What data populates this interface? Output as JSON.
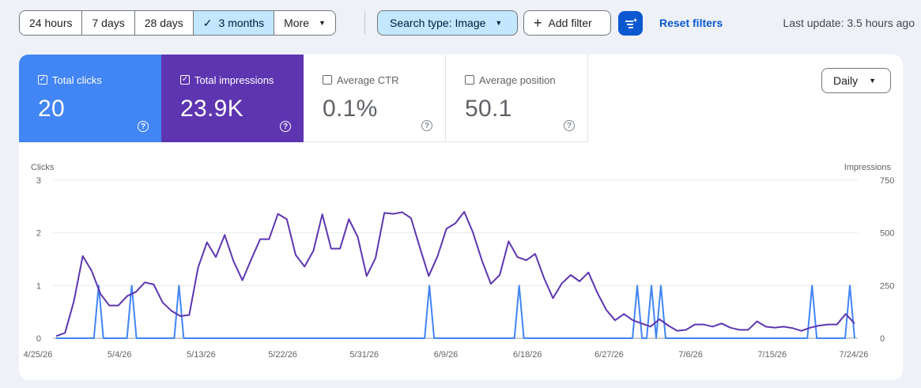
{
  "toolbar": {
    "ranges": [
      {
        "label": "24 hours"
      },
      {
        "label": "7 days"
      },
      {
        "label": "28 days"
      },
      {
        "label": "3 months",
        "selected": true
      },
      {
        "label": "More"
      }
    ],
    "search_type_label": "Search type: Image",
    "add_filter_label": "Add filter",
    "reset_filters_label": "Reset filters",
    "last_update": "Last update: 3.5 hours ago"
  },
  "metrics": {
    "clicks": {
      "label": "Total clicks",
      "value": "20",
      "checked": true
    },
    "impressions": {
      "label": "Total impressions",
      "value": "23.9K",
      "checked": true
    },
    "ctr": {
      "label": "Average CTR",
      "value": "0.1%",
      "checked": false
    },
    "position": {
      "label": "Average position",
      "value": "50.1",
      "checked": false
    }
  },
  "granularity": {
    "selected": "Daily"
  },
  "colors": {
    "clicks": "#4285f4",
    "impressions": "#5e35b1",
    "selected_chip": "#c2e7ff",
    "link": "#0b57d0"
  },
  "chart_data": {
    "type": "line",
    "left_axis_label": "Clicks",
    "right_axis_label": "Impressions",
    "left_ylim": [
      0,
      3
    ],
    "right_ylim": [
      0,
      750
    ],
    "left_ticks": [
      "3",
      "2",
      "1",
      "0"
    ],
    "right_ticks": [
      "750",
      "500",
      "250",
      "0"
    ],
    "x_tick_labels": [
      "4/25/26",
      "5/4/26",
      "5/13/26",
      "5/22/26",
      "5/31/26",
      "6/9/26",
      "6/18/26",
      "6/27/26",
      "7/6/26",
      "7/15/26",
      "7/24/26"
    ],
    "grid": true,
    "series": [
      {
        "name": "Clicks",
        "axis": "left",
        "values": [
          0,
          0,
          0,
          0,
          0,
          0,
          0,
          0,
          0,
          1,
          0,
          0,
          0,
          0,
          0,
          0,
          1,
          0,
          0,
          0,
          0,
          0,
          0,
          0,
          0,
          0,
          1,
          0,
          0,
          0,
          0,
          0,
          0,
          0,
          0,
          0,
          0,
          0,
          0,
          0,
          0,
          0,
          0,
          0,
          0,
          0,
          0,
          0,
          0,
          0,
          0,
          0,
          0,
          0,
          0,
          0,
          0,
          0,
          0,
          0,
          0,
          0,
          0,
          0,
          0,
          0,
          0,
          0,
          0,
          0,
          0,
          0,
          0,
          0,
          0,
          0,
          0,
          0,
          0,
          1,
          0,
          0,
          0,
          0,
          0,
          0,
          0,
          0,
          0,
          0,
          0,
          0,
          0,
          0,
          0,
          0,
          0,
          0,
          1,
          0,
          0,
          0,
          0,
          0,
          0,
          0,
          0,
          0,
          0,
          0,
          0,
          0,
          0,
          0,
          0,
          0,
          0,
          0,
          0,
          0,
          0,
          0,
          0,
          1,
          0,
          0,
          1,
          0,
          1,
          0,
          0,
          0,
          0,
          0,
          0,
          0,
          0,
          0,
          0,
          0,
          0,
          0,
          0,
          0,
          0,
          0,
          0,
          0,
          0,
          0,
          0,
          0,
          0,
          0,
          0,
          0,
          0,
          0,
          0,
          0,
          1,
          0,
          0,
          0,
          0,
          0,
          0,
          0,
          1,
          0
        ]
      },
      {
        "name": "Impressions",
        "axis": "right",
        "values": [
          10,
          25,
          175,
          390,
          320,
          210,
          155,
          155,
          200,
          220,
          265,
          255,
          170,
          130,
          105,
          110,
          335,
          455,
          385,
          490,
          365,
          275,
          375,
          470,
          470,
          590,
          565,
          395,
          340,
          415,
          588,
          425,
          425,
          565,
          480,
          295,
          380,
          595,
          590,
          598,
          570,
          430,
          295,
          390,
          520,
          545,
          600,
          500,
          368,
          258,
          300,
          460,
          385,
          370,
          400,
          285,
          190,
          260,
          300,
          270,
          312,
          216,
          135,
          85,
          115,
          85,
          70,
          55,
          90,
          60,
          35,
          40,
          65,
          65,
          55,
          70,
          50,
          40,
          40,
          80,
          55,
          50,
          55,
          48,
          35,
          50,
          60,
          65,
          65,
          115,
          70
        ]
      }
    ]
  }
}
